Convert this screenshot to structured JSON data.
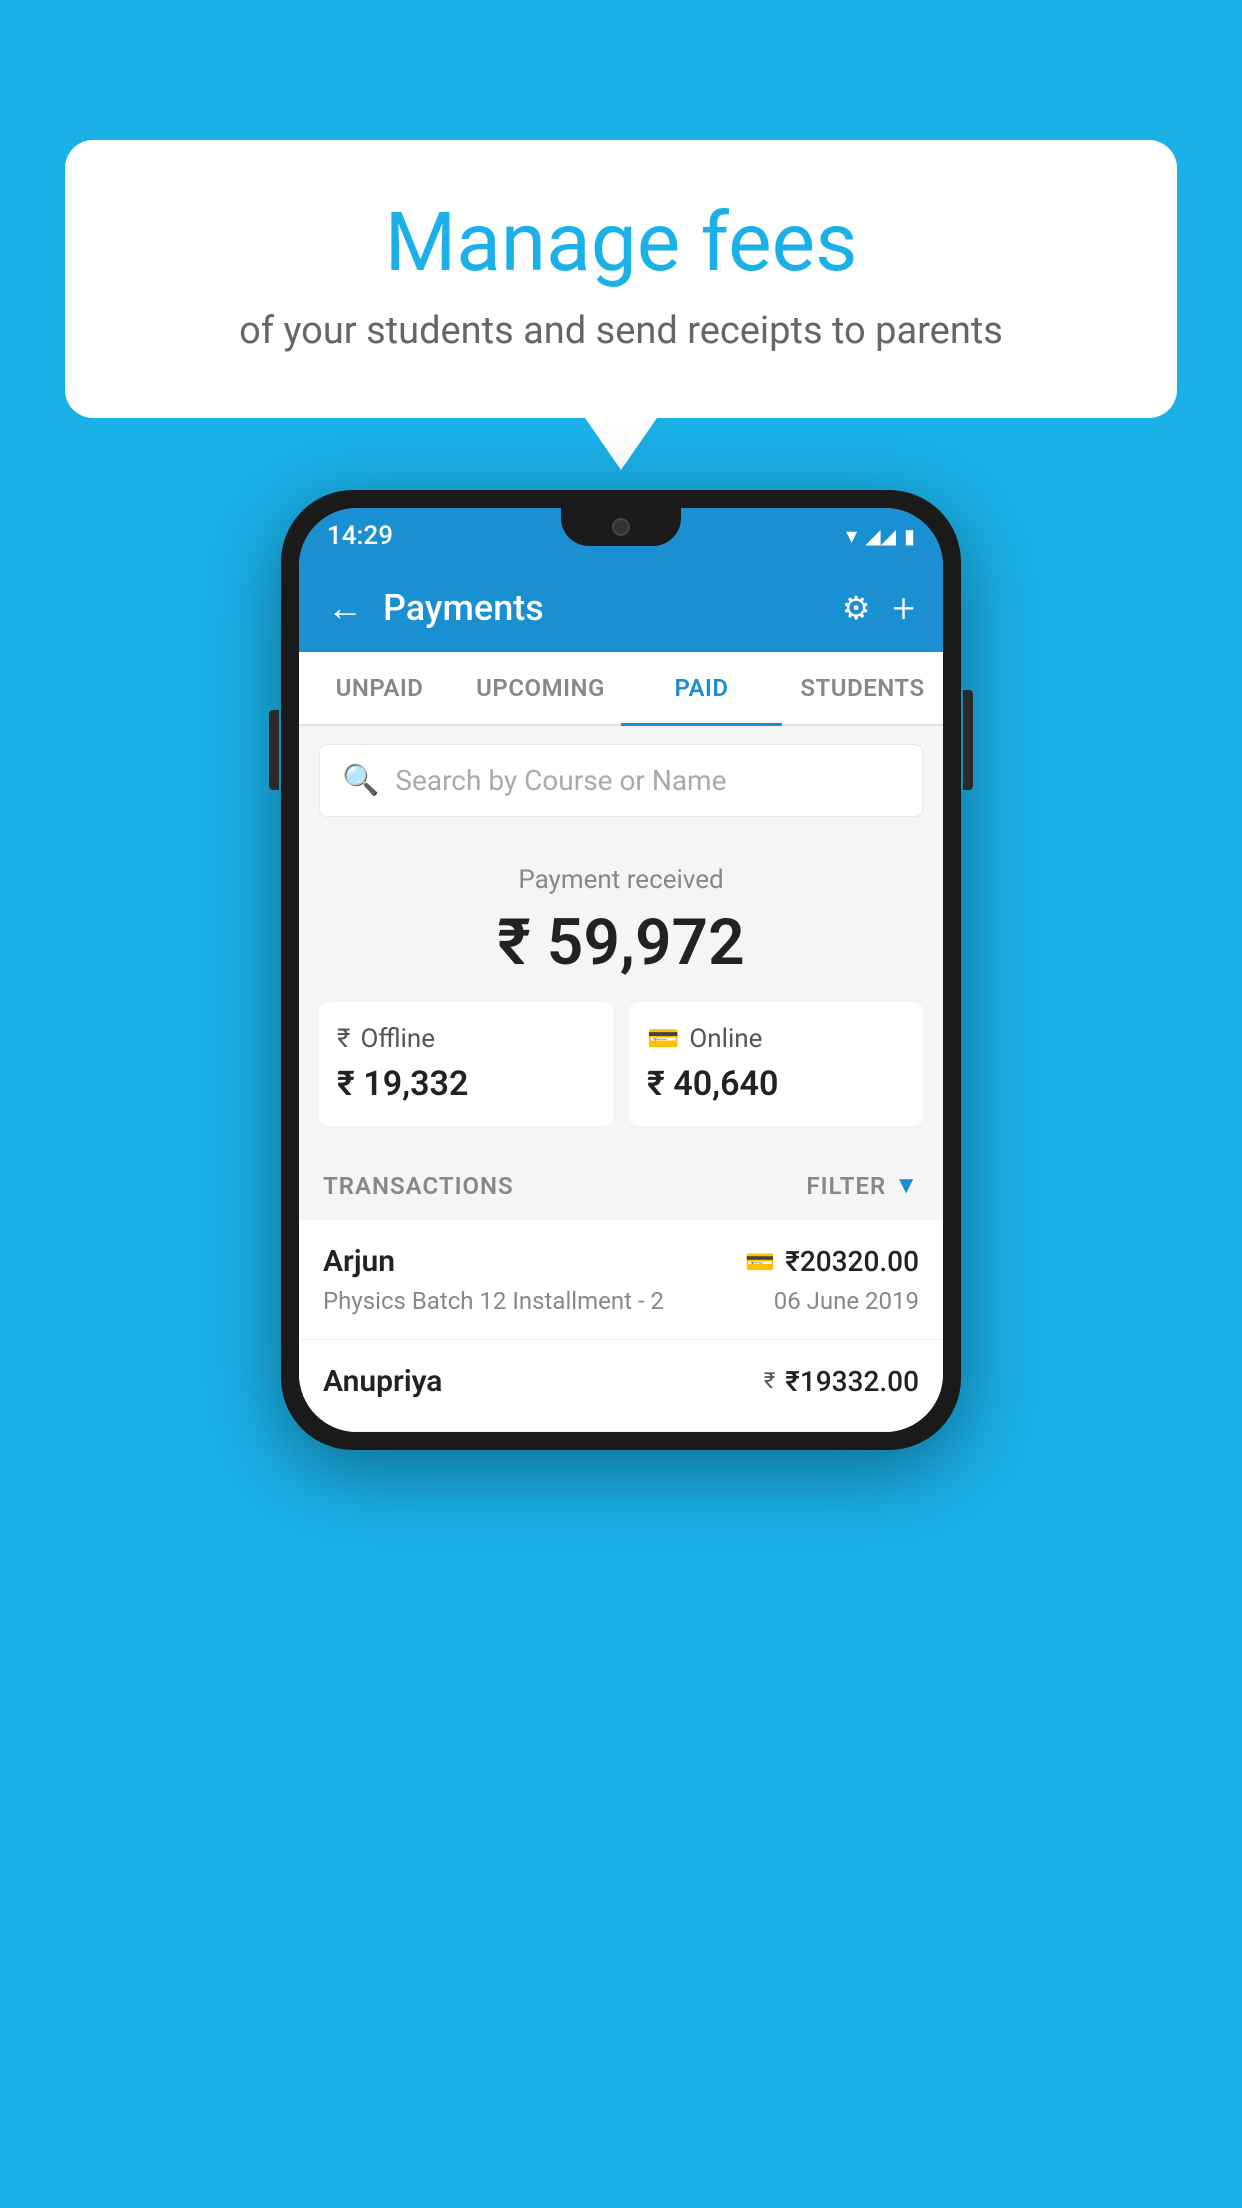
{
  "background_color": "#1ab0e8",
  "speech_bubble": {
    "title": "Manage fees",
    "subtitle": "of your students and send receipts to parents"
  },
  "phone": {
    "status_bar": {
      "time": "14:29",
      "wifi": "▾",
      "signal": "▴",
      "battery": "▮"
    },
    "header": {
      "title": "Payments",
      "back_label": "←",
      "settings_label": "⚙",
      "add_label": "+"
    },
    "tabs": [
      {
        "label": "UNPAID",
        "active": false
      },
      {
        "label": "UPCOMING",
        "active": false
      },
      {
        "label": "PAID",
        "active": true
      },
      {
        "label": "STUDENTS",
        "active": false
      }
    ],
    "search": {
      "placeholder": "Search by Course or Name"
    },
    "payment_summary": {
      "label": "Payment received",
      "total": "₹ 59,972",
      "offline_label": "Offline",
      "offline_amount": "₹ 19,332",
      "online_label": "Online",
      "online_amount": "₹ 40,640"
    },
    "transactions_section": {
      "label": "TRANSACTIONS",
      "filter_label": "FILTER"
    },
    "transactions": [
      {
        "name": "Arjun",
        "course": "Physics Batch 12 Installment - 2",
        "amount": "₹20320.00",
        "date": "06 June 2019",
        "payment_type": "card"
      },
      {
        "name": "Anupriya",
        "course": "",
        "amount": "₹19332.00",
        "date": "",
        "payment_type": "cash"
      }
    ]
  }
}
